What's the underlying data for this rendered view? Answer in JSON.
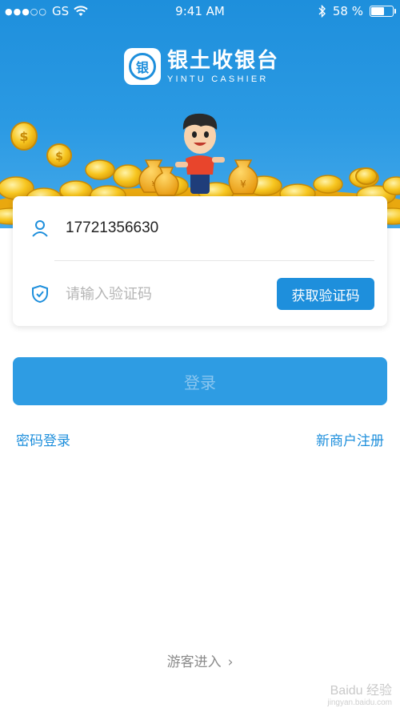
{
  "status_bar": {
    "carrier": "GS",
    "time": "9:41 AM",
    "battery_percent": "58 %",
    "battery_level": 0.58
  },
  "logo": {
    "mark_char": "银",
    "title_cn": "银土收银台",
    "title_en": "YINTU CASHIER"
  },
  "form": {
    "phone_value": "17721356630",
    "code_placeholder": "请输入验证码",
    "get_code_label": "获取验证码"
  },
  "actions": {
    "login_label": "登录",
    "password_login": "密码登录",
    "register": "新商户注册",
    "guest_entry": "游客进入",
    "guest_chevron": "›"
  },
  "watermark": {
    "brand": "Baidu 经验",
    "url": "jingyan.baidu.com"
  },
  "colors": {
    "brand_blue": "#1e8fdc",
    "login_button": "#2e9ce3",
    "coin_gold": "#f5c21b"
  }
}
